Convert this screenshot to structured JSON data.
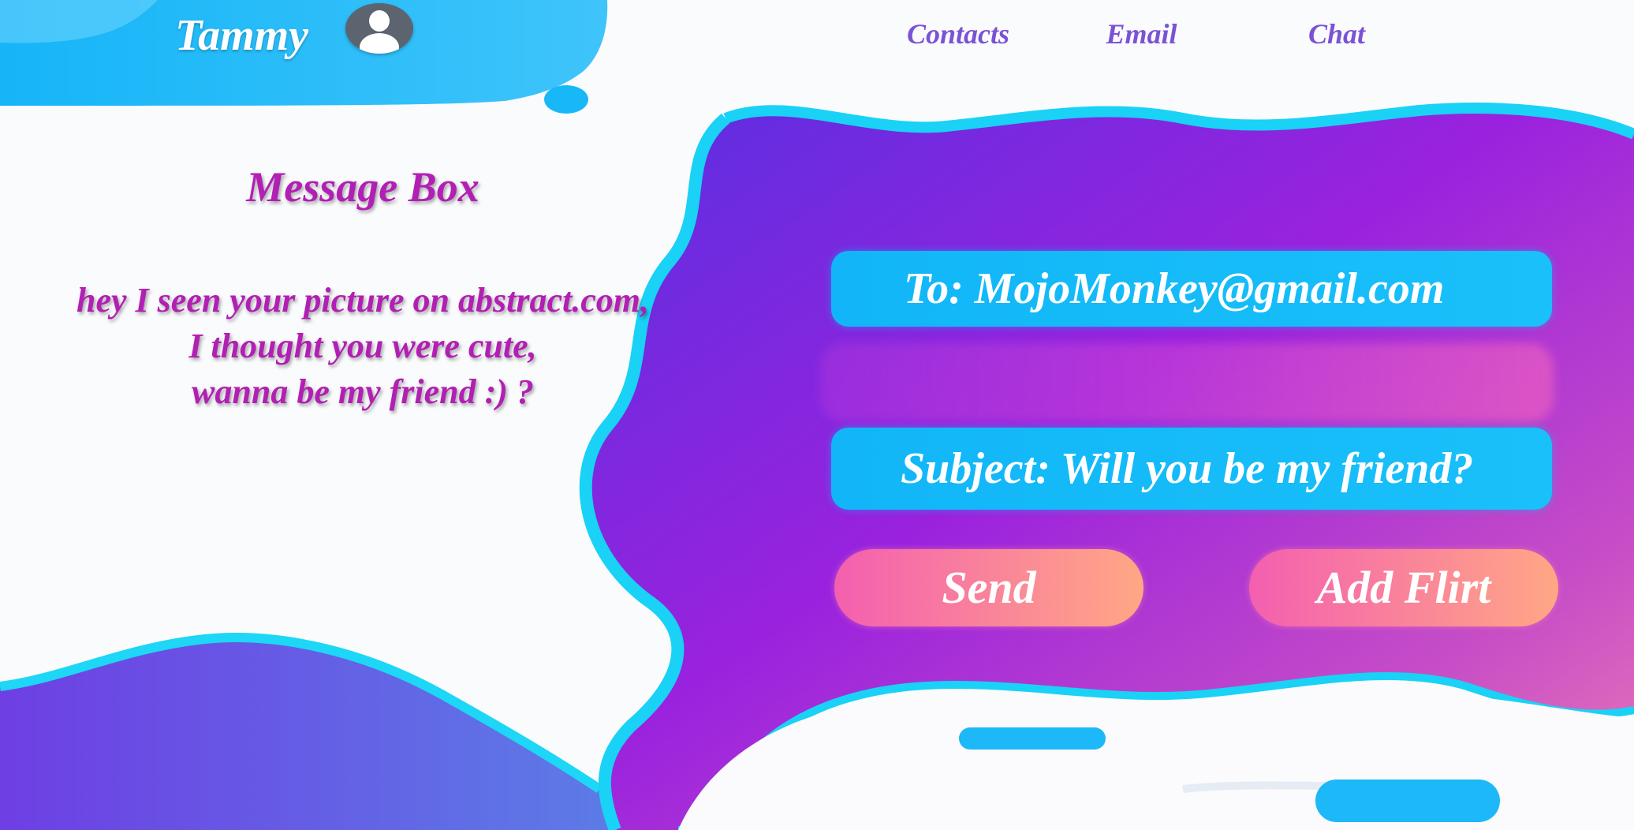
{
  "header": {
    "username": "Tammy",
    "avatar_icon": "user-avatar-icon",
    "nav": [
      "Contacts",
      "Email",
      "Chat"
    ]
  },
  "message_box": {
    "title": "Message Box",
    "lines": [
      "hey I seen your picture on abstract.com,",
      "I thought you were cute,",
      "wanna be my friend :) ?"
    ]
  },
  "compose": {
    "to": "To: MojoMonkey@gmail.com",
    "subject": "Subject: Will you be my friend?",
    "send_label": "Send",
    "add_flirt_label": "Add Flirt"
  },
  "colors": {
    "accent_blue": "#12b6f8",
    "purple_blob": "#8a2be2",
    "magenta_text": "#b21fb3",
    "nav_purple": "#7a52d6",
    "button_pink": "#f45fb0",
    "button_peach": "#ffa785"
  }
}
